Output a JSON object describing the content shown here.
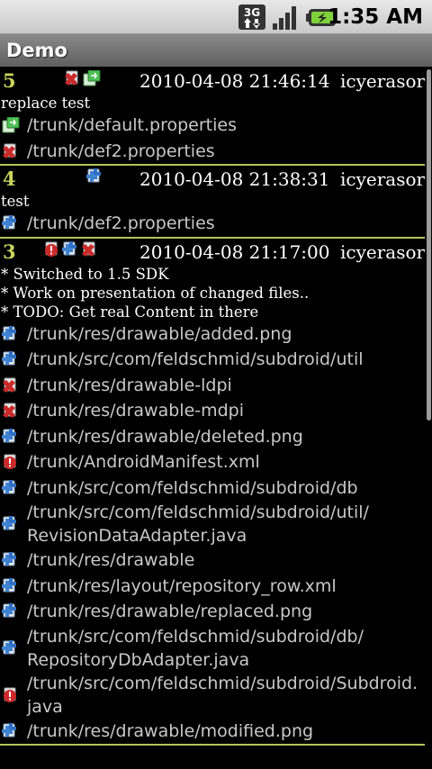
{
  "status_bar": {
    "network_label": "3G",
    "time": "1:35 AM",
    "icons": [
      "network-3g-icon",
      "signal-strength-icon",
      "battery-charging-icon"
    ],
    "colors": {
      "battery": "#7fd13b"
    }
  },
  "title_bar": {
    "title": "Demo"
  },
  "colors": {
    "accent": "#c8d45c",
    "added": "#3f82d1",
    "deleted": "#cc2a2a",
    "replaced": "#3bb04a",
    "text": "#ffffff",
    "path": "#c8c8c8"
  },
  "revisions": [
    {
      "number": "5",
      "date": "2010-04-08 21:46:14",
      "author": "icyerasor",
      "change_icons": [
        "deleted-icon",
        "replaced-icon"
      ],
      "message": "replace test",
      "files": [
        {
          "icon": "replaced-icon",
          "path": "/trunk/default.properties"
        },
        {
          "icon": "deleted-icon",
          "path": "/trunk/def2.properties"
        }
      ]
    },
    {
      "number": "4",
      "date": "2010-04-08 21:38:31",
      "author": "icyerasor",
      "change_icons": [
        "added-icon"
      ],
      "message": "test",
      "files": [
        {
          "icon": "added-icon",
          "path": "/trunk/def2.properties"
        }
      ]
    },
    {
      "number": "3",
      "date": "2010-04-08 21:17:00",
      "author": "icyerasor",
      "change_icons": [
        "modified-icon",
        "added-icon",
        "deleted-icon"
      ],
      "message": "* Switched to 1.5 SDK\n* Work on presentation of changed files..\n* TODO: Get real Content in there",
      "files": [
        {
          "icon": "added-icon",
          "path": "/trunk/res/drawable/added.png"
        },
        {
          "icon": "added-icon",
          "path": "/trunk/src/com/feldschmid/subdroid/util"
        },
        {
          "icon": "deleted-icon",
          "path": "/trunk/res/drawable-ldpi"
        },
        {
          "icon": "deleted-icon",
          "path": "/trunk/res/drawable-mdpi"
        },
        {
          "icon": "added-icon",
          "path": "/trunk/res/drawable/deleted.png"
        },
        {
          "icon": "modified-icon",
          "path": "/trunk/AndroidManifest.xml"
        },
        {
          "icon": "added-icon",
          "path": "/trunk/src/com/feldschmid/subdroid/db"
        },
        {
          "icon": "added-icon",
          "path": "/trunk/src/com/feldschmid/subdroid/util/\nRevisionDataAdapter.java"
        },
        {
          "icon": "added-icon",
          "path": "/trunk/res/drawable"
        },
        {
          "icon": "added-icon",
          "path": "/trunk/res/layout/repository_row.xml"
        },
        {
          "icon": "added-icon",
          "path": "/trunk/res/drawable/replaced.png"
        },
        {
          "icon": "added-icon",
          "path": "/trunk/src/com/feldschmid/subdroid/db/\nRepositoryDbAdapter.java"
        },
        {
          "icon": "modified-icon",
          "path": "/trunk/src/com/feldschmid/subdroid/Subdroid.\njava"
        },
        {
          "icon": "added-icon",
          "path": "/trunk/res/drawable/modified.png"
        }
      ]
    }
  ]
}
